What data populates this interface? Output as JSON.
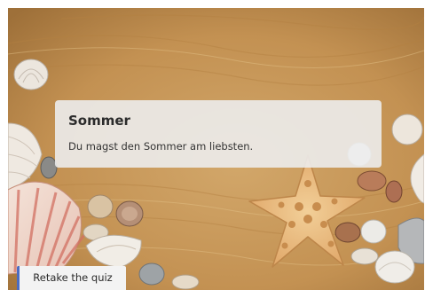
{
  "result": {
    "title": "Sommer",
    "description": "Du magst den Sommer am liebsten."
  },
  "actions": {
    "retake_label": "Retake the quiz"
  },
  "background": {
    "image": "sand-beach-with-seashells-and-starfish"
  },
  "colors": {
    "accent": "#4a6cc4",
    "card_background": "#ececec",
    "sand": "#c69a5e"
  }
}
